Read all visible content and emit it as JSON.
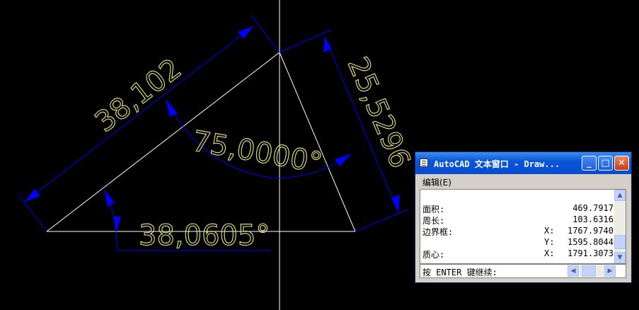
{
  "drawing": {
    "dim_side_top": "38,102",
    "dim_side_right": "25,5296",
    "dim_angle_top": "75,0000°",
    "dim_angle_bottom": "38,0605°",
    "colors": {
      "background": "#000000",
      "geometry": "#ffffff",
      "dimension_line": "#0000ff",
      "dimension_text": "#e6e67a"
    }
  },
  "text_window": {
    "title": "AutoCAD 文本窗口 - Draw...",
    "menu": {
      "edit": "编辑(E)"
    },
    "lines": [
      {
        "label": "面积:",
        "axis": "",
        "value": "469.7917"
      },
      {
        "label": "周长:",
        "axis": "",
        "value": "103.6316"
      },
      {
        "label": "边界框:",
        "axis": "X:",
        "value": "1767.9740"
      },
      {
        "label": "",
        "axis": "Y:",
        "value": "1595.8044"
      },
      {
        "label": "质心:",
        "axis": "X:",
        "value": "1791.3073"
      }
    ],
    "prompt": "按 ENTER 键继续:",
    "icons": [
      "window-menu-icon",
      "minimize-icon",
      "maximize-icon",
      "close-icon"
    ]
  }
}
